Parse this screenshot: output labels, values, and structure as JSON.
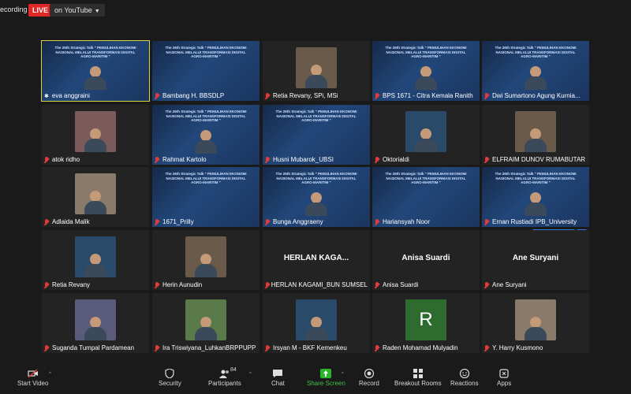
{
  "topbar": {
    "recording": "ecording",
    "live": "LIVE",
    "youtube": "on YouTube"
  },
  "webinar_banner": "The 26th Strategic Talk\n\" PEMULIHAN EKONOMI NASIONAL MELALUI\nTRANSFORMASI DIGITAL AGRO-MARITIM \"",
  "tiles": [
    {
      "name": "eva anggraini",
      "kind": "banner-person",
      "active": true
    },
    {
      "name": "Bambang H. BBSDLP",
      "kind": "banner"
    },
    {
      "name": "Retia Revany, SPi, MSi",
      "kind": "photo"
    },
    {
      "name": "BPS 1671 - Citra Kemala Ranith",
      "kind": "banner-person"
    },
    {
      "name": "Dwi Sumartono Agung Kurnia...",
      "kind": "banner-person"
    },
    {
      "name": "atok ridho",
      "kind": "photo"
    },
    {
      "name": "Rahmat Kartolo",
      "kind": "banner-person"
    },
    {
      "name": "Husni Mubarok_UBSI",
      "kind": "banner"
    },
    {
      "name": "Oktorialdi",
      "kind": "photo"
    },
    {
      "name": "ELFRAIM DUNOV RUMABUTAR",
      "kind": "photo"
    },
    {
      "name": "Adlaida Malik",
      "kind": "photo"
    },
    {
      "name": "1671_Prilly",
      "kind": "banner"
    },
    {
      "name": "Bunga Anggraeny",
      "kind": "banner-person"
    },
    {
      "name": "Hariansyah Noor",
      "kind": "banner"
    },
    {
      "name": "Ernan Rustiadi IPB_University",
      "kind": "banner-person"
    },
    {
      "name": "Retia Revany",
      "kind": "photo"
    },
    {
      "name": "Herin Aunudin",
      "kind": "photo"
    },
    {
      "name": "HERLAN KAGAMI_BUN SUMSEL",
      "kind": "text",
      "big": "HERLAN KAGA..."
    },
    {
      "name": "Anisa Suardi",
      "kind": "text",
      "big": "Anisa Suardi"
    },
    {
      "name": "Ane Suryani",
      "kind": "text",
      "big": "Ane Suryani"
    },
    {
      "name": "Suganda Tumpal Pardamean",
      "kind": "photo"
    },
    {
      "name": "Ira Triswiyana_LuhkanBRPPUPP",
      "kind": "photo"
    },
    {
      "name": "Irsyan M - BKF Kemenkeu",
      "kind": "photo"
    },
    {
      "name": "Raden Mohamad Mulyadin",
      "kind": "letter",
      "letter": "R"
    },
    {
      "name": "Y. Harry Kusmono",
      "kind": "photo"
    }
  ],
  "overlay": {
    "ask_to_unmute": "Ask to Unmute",
    "more": "•••"
  },
  "toolbar": {
    "start_video": "Start Video",
    "security": "Security",
    "participants": "Participants",
    "participants_count": "84",
    "chat": "Chat",
    "share_screen": "Share Screen",
    "record": "Record",
    "breakout_rooms": "Breakout Rooms",
    "reactions": "Reactions",
    "apps": "Apps"
  },
  "colors": {
    "active_border": "#d9d43a",
    "live": "#e02828",
    "unmute": "#2d7de0",
    "share": "#2bb52b"
  }
}
